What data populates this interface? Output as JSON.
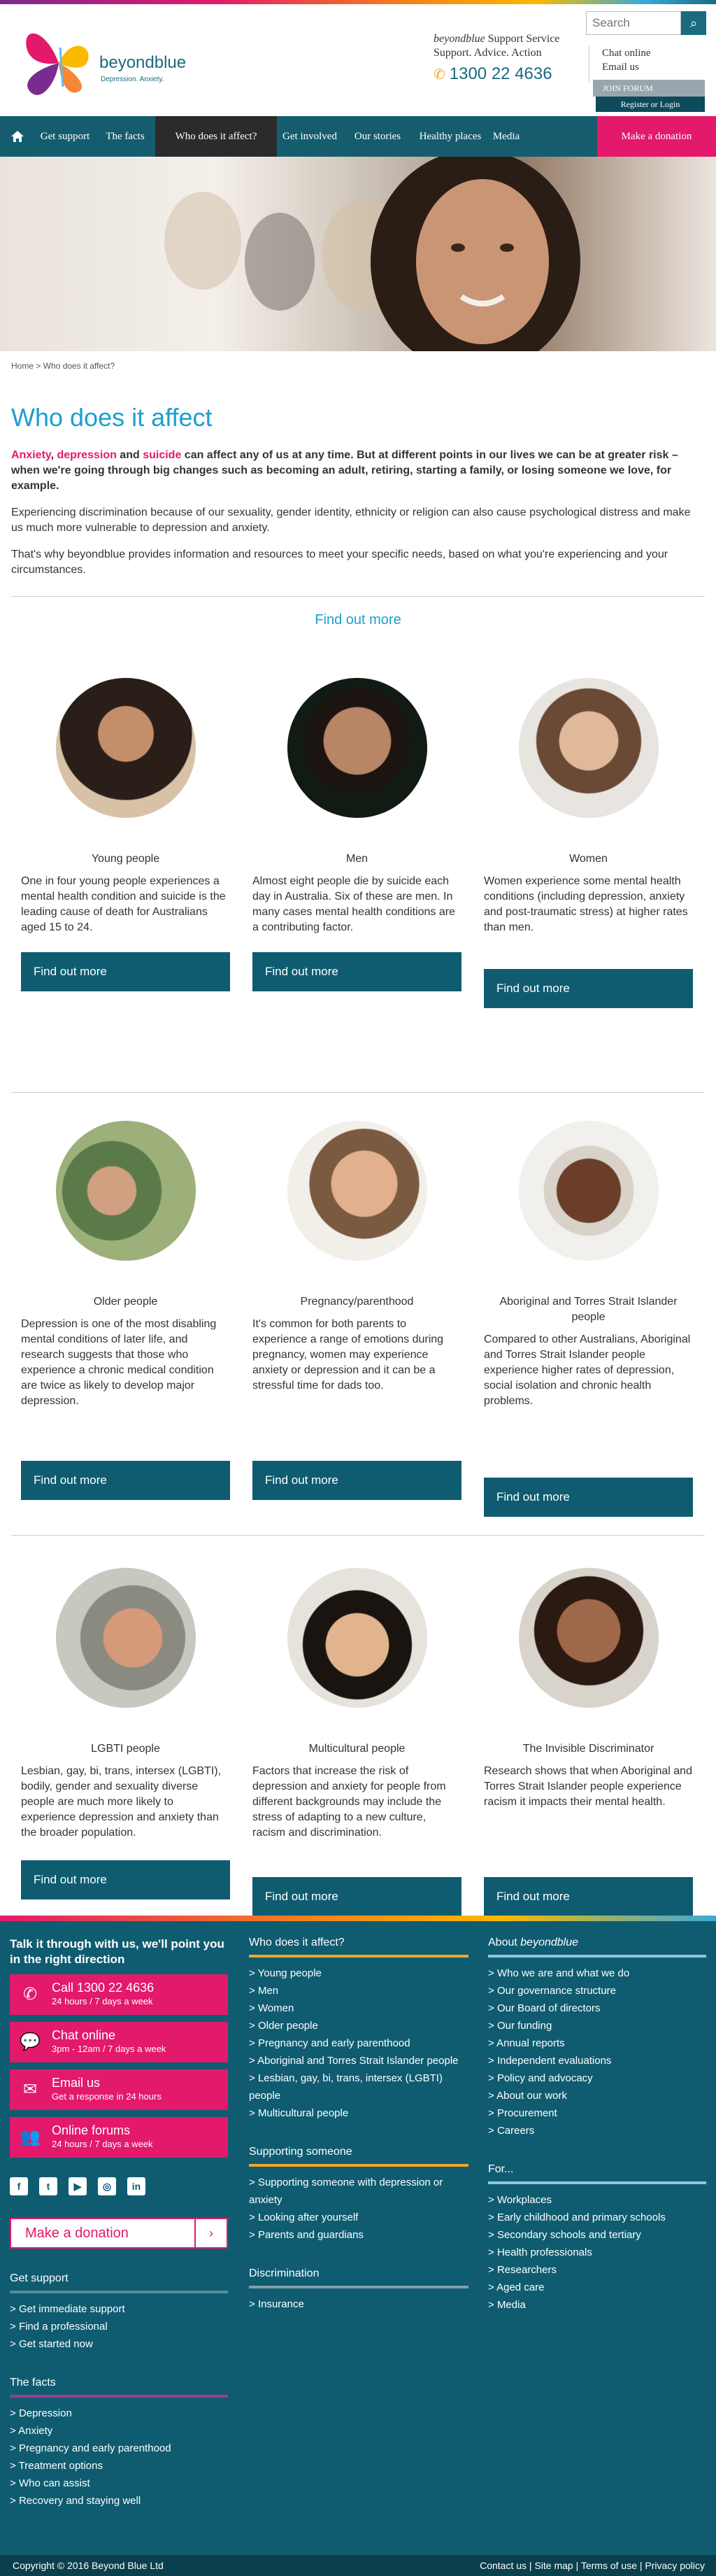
{
  "header": {
    "search_placeholder": "Search",
    "tagline_brand": "beyondblue",
    "tagline_rest": " Support Service",
    "tagline_line2": "Support. Advice. Action",
    "phone": "1300 22 4636",
    "chat_online": "Chat online",
    "email_us": "Email us",
    "join_forum": "JOIN FORUM",
    "register_login": "Register  or  Login",
    "logo_word": "beyondblue",
    "logo_tag": "Depression. Anxiety."
  },
  "nav": {
    "items": [
      "Get support",
      "The facts",
      "Who does it affect?",
      "Get involved",
      "Our stories",
      "Healthy places",
      "Media"
    ],
    "donate": "Make a donation"
  },
  "breadcrumb": "Home > Who does it affect?",
  "page": {
    "title": "Who does it affect",
    "intro_a": "Anxiety",
    "intro_b": ", ",
    "intro_c": "depression",
    "intro_d": " and ",
    "intro_e": "suicide",
    "intro_f": " can affect any of us at any time. But at different points in our lives we can be at greater risk – when we're going through big changes such as becoming an adult, retiring, starting a family, or losing someone we love, for example.",
    "p1": "Experiencing discrimination because of our sexuality, gender identity, ethnicity or religion can also cause psychological distress and make us much more vulnerable to depression and anxiety.",
    "p2": "That's why beyondblue provides information and resources to meet your specific needs, based on what you're experiencing and your circumstances.",
    "find_more_heading": "Find out more"
  },
  "cards": [
    {
      "title": "Young people",
      "desc": "One in four young people experiences a mental health condition and suicide is the leading cause of death for Australians aged 15 to 24.",
      "btn": "Find out more"
    },
    {
      "title": "Men",
      "desc": "Almost eight people die by suicide each day in Australia. Six of these are men. In many cases mental health conditions are a contributing factor.",
      "btn": "Find out more"
    },
    {
      "title": "Women",
      "desc": "Women experience some mental health conditions (including depression, anxiety and post-traumatic stress) at higher rates than men.",
      "btn": "Find out more"
    },
    {
      "title": "Older people",
      "desc": "Depression is one of the most disabling mental conditions of later life, and research suggests that those who experience a chronic medical condition are twice as likely to develop major depression.",
      "btn": "Find out more"
    },
    {
      "title": "Pregnancy/parenthood",
      "desc": "It's common for both parents to experience a range of emotions during pregnancy, women may experience anxiety or depression and it can be a stressful time for dads too.",
      "btn": "Find out more"
    },
    {
      "title": "Aboriginal and Torres Strait Islander people",
      "desc": "Compared to other Australians, Aboriginal and Torres Strait Islander people experience higher rates of depression, social isolation and chronic health problems.",
      "btn": "Find out more"
    },
    {
      "title": "LGBTI people",
      "desc": "Lesbian, gay, bi, trans, intersex (LGBTI), bodily, gender and sexuality diverse people are much more likely to experience depression and anxiety than the broader population.",
      "btn": "Find out more"
    },
    {
      "title": "Multicultural people",
      "desc": "Factors that increase the risk of depression and anxiety for people from different backgrounds may include the stress of adapting to a new culture, racism and discrimination.",
      "btn": "Find out more"
    },
    {
      "title": "The Invisible Discriminator",
      "desc": "Research shows that when Aboriginal and Torres Strait Islander people experience racism it impacts their mental health.",
      "btn": "Find out more"
    }
  ],
  "footer": {
    "talk_title": "Talk it through with us, we'll point you in the right direction",
    "call_title": "Call 1300 22 4636",
    "call_sub": "24 hours / 7 days a week",
    "chat_title": "Chat online",
    "chat_sub": "3pm - 12am / 7 days a week",
    "email_title": "Email us",
    "email_sub": "Get a response in 24 hours",
    "forum_title": "Online forums",
    "forum_sub": "24 hours / 7 days a week",
    "donate": "Make a donation",
    "get_support": "Get support",
    "get_support_links": [
      "Get immediate support",
      "Find a professional",
      "Get started now"
    ],
    "facts": "The facts",
    "facts_links": [
      "Depression",
      "Anxiety",
      "Pregnancy and early parenthood",
      "Treatment options",
      "Who can assist",
      "Recovery and staying well"
    ],
    "who": "Who does it affect?",
    "who_links": [
      "Young people",
      "Men",
      "Women",
      "Older people",
      "Pregnancy and early parenthood",
      "Aboriginal and Torres Strait Islander people",
      "Lesbian, gay, bi, trans, intersex (LGBTI) people",
      "Multicultural people"
    ],
    "supporting": "Supporting someone",
    "supporting_links": [
      "Supporting someone with depression or anxiety",
      "Looking after yourself",
      "Parents and guardians"
    ],
    "discrimination": "Discrimination",
    "discrimination_links": [
      "Insurance"
    ],
    "about_pre": "About ",
    "about_brand": "beyondblue",
    "about_links": [
      "Who we are and what we do",
      "Our governance structure",
      "Our Board of directors",
      "Our funding",
      "Annual reports",
      "Independent evaluations",
      "Policy and advocacy",
      "About our work",
      "Procurement",
      "Careers"
    ],
    "for": "For...",
    "for_links": [
      "Workplaces",
      "Early childhood and primary schools",
      "Secondary schools and tertiary",
      "Health professionals",
      "Researchers",
      "Aged care",
      "Media"
    ],
    "copyright": "Copyright © 2016 Beyond Blue Ltd",
    "bottom_links": "Contact us | Site map | Terms of use | Privacy policy"
  }
}
